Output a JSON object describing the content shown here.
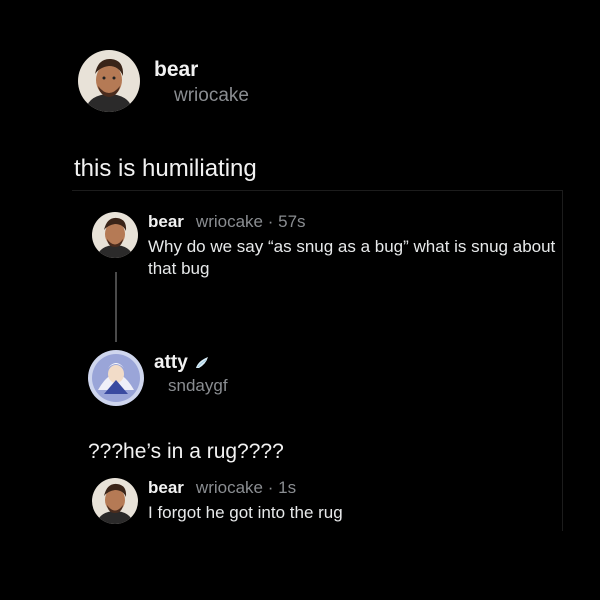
{
  "header": {
    "display_name": "bear",
    "handle": "wriocake"
  },
  "post": {
    "text": "this is humiliating"
  },
  "quoted_post": {
    "display_name": "bear",
    "handle_time": "wriocake · 57s",
    "text": "Why do we say “as snug as a bug” what is snug about that bug"
  },
  "reply_author": {
    "display_name": "atty",
    "handle": "sndaygf",
    "badge_icon": "wing-icon"
  },
  "reply": {
    "text": "???he’s in a rug????"
  },
  "nested_reply": {
    "display_name": "bear",
    "handle_time": "wriocake · 1s",
    "text": "I forgot he got into the rug"
  },
  "colors": {
    "background": "#000000",
    "text": "#f2f2f2",
    "muted": "#8a8d91"
  }
}
